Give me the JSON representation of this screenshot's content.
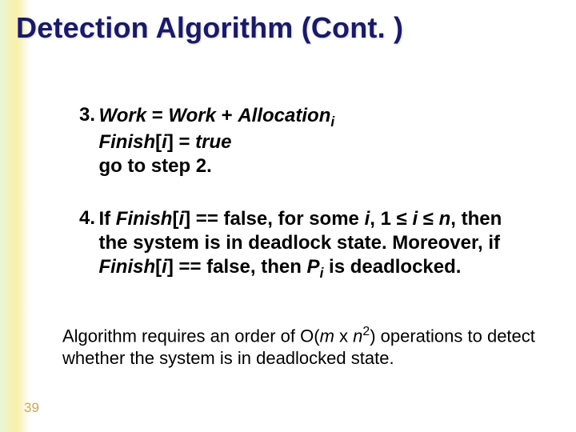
{
  "title": "Detection Algorithm (Cont. )",
  "step3": {
    "num": "3.",
    "l1a": "Work",
    "l1b": " = ",
    "l1c": "Work",
    "l1d": " + ",
    "l1e": "Allocation",
    "l1f": "i",
    "l2a": "Finish",
    "l2b": "[",
    "l2c": "i",
    "l2d": "] = ",
    "l2e": "true",
    "l3": "go to step 2."
  },
  "step4": {
    "num": "4.",
    "a": "If ",
    "b": "Finish",
    "c": "[",
    "d": "i",
    "e": "] == false, for some ",
    "f": "i",
    "g": ", 1 ",
    "leq1": "≤",
    "h": " ",
    "i": "i",
    "j": " ",
    "leq2": "≤",
    "k": "  ",
    "n": "n",
    "l": ", then the system is in deadlock state. Moreover, if ",
    "m": "Finish",
    "o": "[",
    "p": "i",
    "q": "] == false, then ",
    "r": "P",
    "s": "i",
    "t": " is deadlocked."
  },
  "footnote": {
    "a": "Algorithm requires an order of O(",
    "b": "m",
    "c": " x ",
    "d": "n",
    "e": "2",
    "f": ") operations to detect whether the system is in deadlocked state."
  },
  "slide_number": "39"
}
